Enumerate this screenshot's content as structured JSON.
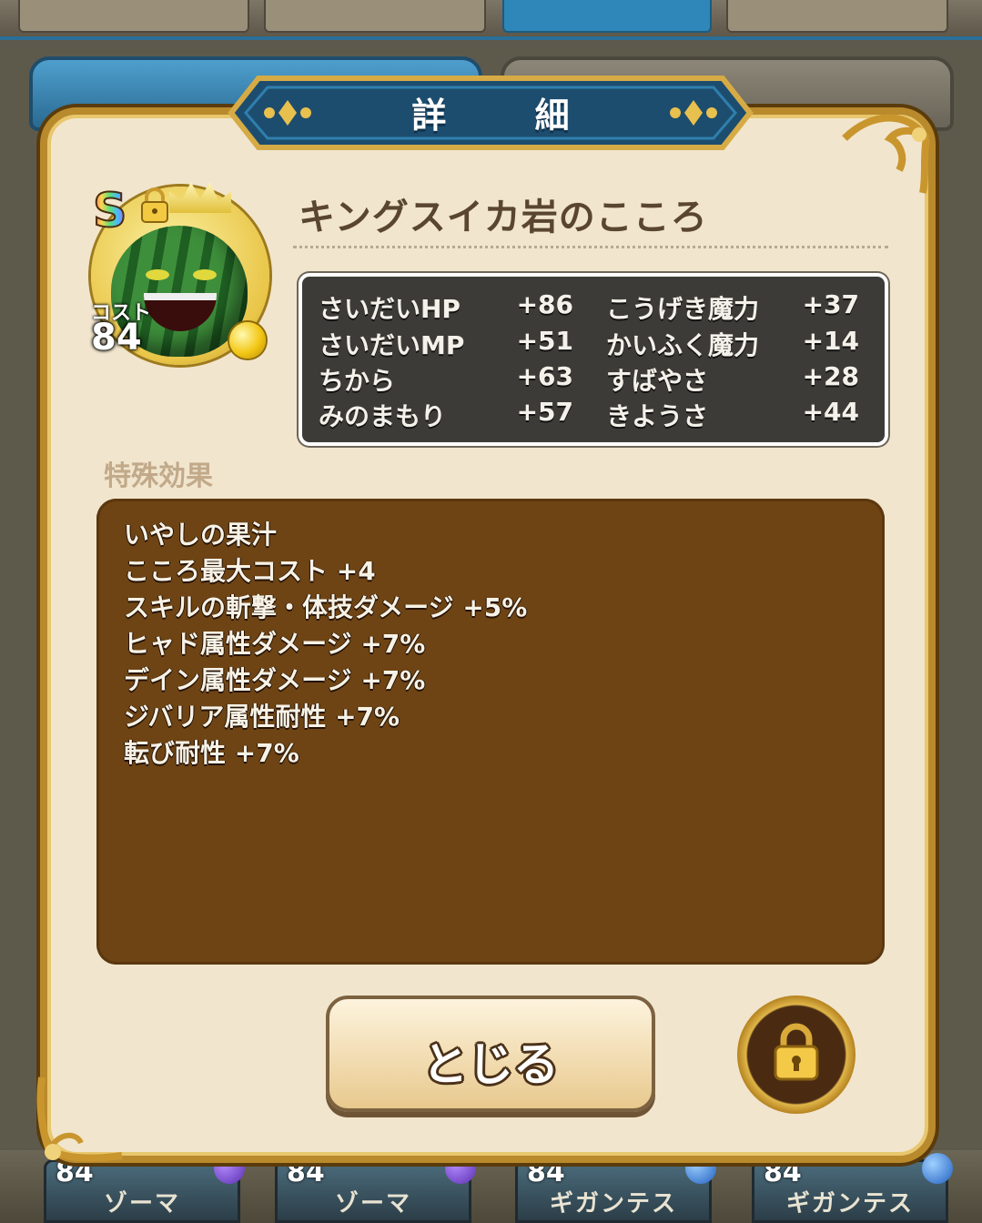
{
  "dialog": {
    "title": "詳 細",
    "item_name": "キングスイカ岩のこころ",
    "rank": "S",
    "cost_label": "コスト",
    "cost_value": "84",
    "stats": [
      {
        "label": "さいだいHP",
        "value": "+86"
      },
      {
        "label": "こうげき魔力",
        "value": "+37"
      },
      {
        "label": "さいだいMP",
        "value": "+51"
      },
      {
        "label": "かいふく魔力",
        "value": "+14"
      },
      {
        "label": "ちから",
        "value": "+63"
      },
      {
        "label": "すばやさ",
        "value": "+28"
      },
      {
        "label": "みのまもり",
        "value": "+57"
      },
      {
        "label": "きようさ",
        "value": "+44"
      }
    ],
    "special_label": "特殊効果",
    "effects": [
      "いやしの果汁",
      "こころ最大コスト +4",
      "スキルの斬撃・体技ダメージ +5%",
      "ヒャド属性ダメージ +7%",
      "デイン属性ダメージ +7%",
      "ジバリア属性耐性 +7%",
      "転び耐性 +7%"
    ],
    "close_label": "とじる",
    "lock_icon": "padlock-icon"
  },
  "background": {
    "cards": [
      {
        "cost": "84",
        "name": "ゾーマ"
      },
      {
        "cost": "84",
        "name": "ゾーマ"
      },
      {
        "cost": "84",
        "name": "ギガンテス"
      },
      {
        "cost": "84",
        "name": "ギガンテス"
      }
    ]
  },
  "colors": {
    "dialog_bg": "#f1e5cd",
    "frame_gold": "#b98a2c",
    "title_blue": "#2a6a92",
    "stats_bg": "#3c3b37",
    "effects_bg": "#6e4414"
  }
}
